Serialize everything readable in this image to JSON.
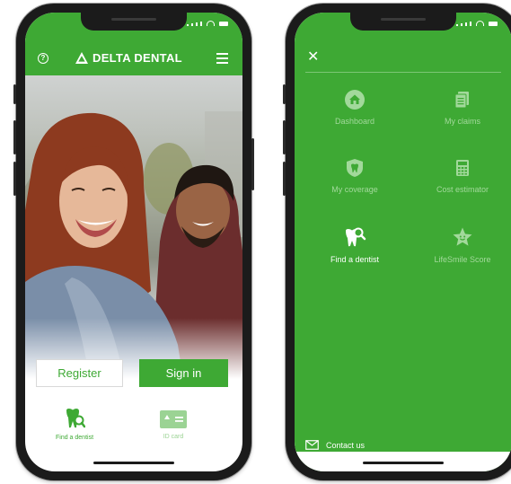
{
  "colors": {
    "brand_green": "#3EA934",
    "muted_label": "#A2D99B",
    "white": "#FFFFFF"
  },
  "left_screen": {
    "header": {
      "help_icon": "question-circle-icon",
      "brand": "DELTA DENTAL",
      "menu_icon": "hamburger-menu-icon"
    },
    "hero": {
      "image": "two-smiling-people-photo"
    },
    "buttons": {
      "register": "Register",
      "sign_in": "Sign in"
    },
    "tabs": [
      {
        "label": "Find a dentist",
        "icon": "tooth-search-icon"
      },
      {
        "label": "ID card",
        "icon": "id-card-icon"
      }
    ]
  },
  "right_screen": {
    "close_icon": "close-icon",
    "menu_items": [
      {
        "label": "Dashboard",
        "icon": "home-icon"
      },
      {
        "label": "My claims",
        "icon": "documents-icon"
      },
      {
        "label": "My coverage",
        "icon": "shield-tooth-icon"
      },
      {
        "label": "Cost estimator",
        "icon": "calculator-icon"
      },
      {
        "label": "Find a dentist",
        "icon": "tooth-search-icon"
      },
      {
        "label": "LifeSmile Score",
        "icon": "star-smile-icon"
      }
    ],
    "contact": {
      "label": "Contact us",
      "icon": "envelope-icon"
    }
  }
}
